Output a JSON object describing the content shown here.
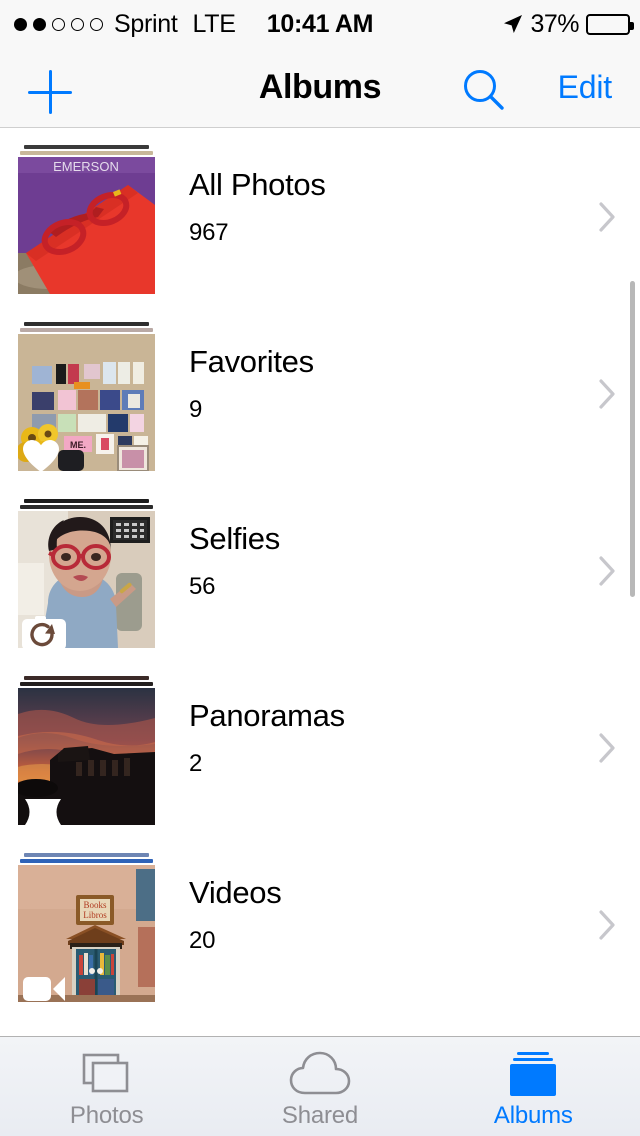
{
  "status_bar": {
    "signal_dots_filled": 2,
    "signal_dots_total": 5,
    "carrier": "Sprint",
    "network": "LTE",
    "time": "10:41 AM",
    "location_icon": "location-arrow-icon",
    "battery_percent": "37%",
    "battery_level": 37,
    "battery_color": "#FECB2E"
  },
  "nav_bar": {
    "add_label": "+",
    "title": "Albums",
    "search_icon": "search-icon",
    "edit_label": "Edit",
    "accent_color": "#007AFF"
  },
  "albums": [
    {
      "title": "All Photos",
      "count": "967",
      "badge": "none",
      "thumb_alt": "red eyeglasses on a red tablet case over a purple book",
      "stack_color_1": "#3A3A3A",
      "stack_color_2": "#C8B89A"
    },
    {
      "title": "Favorites",
      "count": "9",
      "badge": "heart-icon",
      "thumb_alt": "wall collage of photos and cards above sunflowers",
      "stack_color_1": "#2E2E2E",
      "stack_color_2": "#B9A9A5"
    },
    {
      "title": "Selfies",
      "count": "56",
      "badge": "front-camera-icon",
      "thumb_alt": "selfie of a person with red glasses in a blue tank top",
      "stack_color_1": "#1C1C1C",
      "stack_color_2": "#2B2B2B"
    },
    {
      "title": "Panoramas",
      "count": "2",
      "badge": "panorama-icon",
      "thumb_alt": "orange sunset sky over a dark building silhouette",
      "stack_color_1": "#3B2A28",
      "stack_color_2": "#24201F"
    },
    {
      "title": "Videos",
      "count": "20",
      "badge": "video-icon",
      "thumb_alt": "little free library book box labeled Books Libros on a tan wall",
      "stack_color_1": "#6E86B4",
      "stack_color_2": "#2F63B8"
    }
  ],
  "list": {
    "chevron_icon": "chevron-right-icon",
    "scrollbar_visible": true
  },
  "tab_bar": {
    "tabs": [
      {
        "label": "Photos",
        "icon": "photos-stack-icon",
        "active": false
      },
      {
        "label": "Shared",
        "icon": "cloud-icon",
        "active": false
      },
      {
        "label": "Albums",
        "icon": "albums-icon",
        "active": true
      }
    ],
    "active_color": "#007AFF",
    "inactive_color": "#8E8E93"
  }
}
